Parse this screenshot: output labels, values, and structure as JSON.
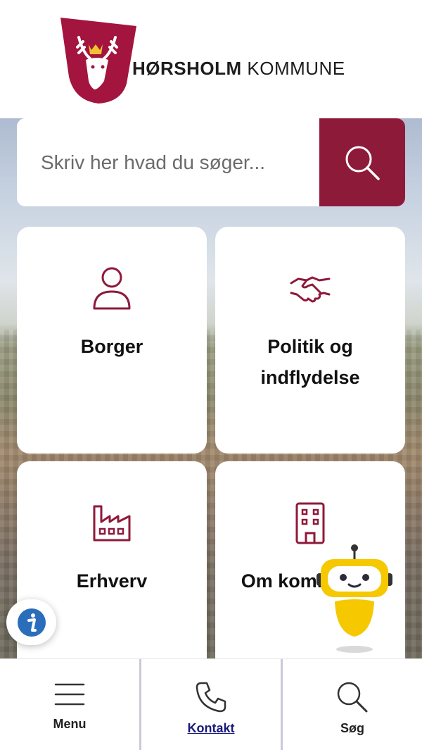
{
  "header": {
    "logo_text_bold": "HØRSHOLM",
    "logo_text_regular": " KOMMUNE",
    "logo_icon": "shield-deer-icon"
  },
  "search": {
    "placeholder": "Skriv her hvad du søger...",
    "value": "",
    "button_icon": "search-icon"
  },
  "cards": [
    {
      "label": "Borger",
      "icon": "person-icon"
    },
    {
      "label": "Politik og indflydelse",
      "icon": "handshake-icon"
    },
    {
      "label": "Erhverv",
      "icon": "factory-icon"
    },
    {
      "label": "Om kommunen",
      "icon": "building-icon"
    }
  ],
  "floating": {
    "info_icon": "info-icon",
    "chatbot_icon": "chatbot-robot-icon"
  },
  "bottom_nav": {
    "items": [
      {
        "label": "Menu",
        "icon": "hamburger-menu-icon"
      },
      {
        "label": "Kontakt",
        "icon": "phone-icon"
      },
      {
        "label": "Søg",
        "icon": "search-icon"
      }
    ]
  },
  "colors": {
    "brand": "#8e1a3a",
    "icon_stroke": "#8e1a3a",
    "info_blue": "#2a6ebb",
    "chatbot_yellow": "#f5c800"
  }
}
